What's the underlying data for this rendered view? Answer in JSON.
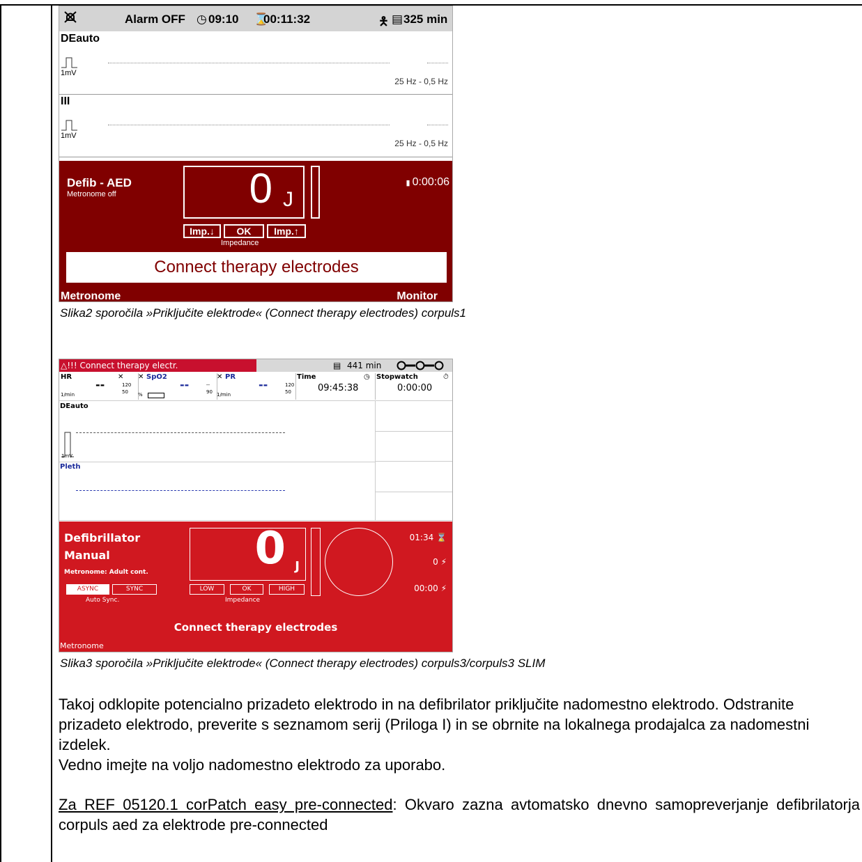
{
  "screen1": {
    "status_bar": {
      "alarm_icon": "alarm-off-icon",
      "alarm": "Alarm OFF",
      "clock_icon": "clock-icon",
      "clock": "09:10",
      "timer_icon": "hourglass-icon",
      "timer": "00:11:32",
      "patient_icon": "patient-adult-icon",
      "battery_icon": "battery-icon",
      "battery": "325 min"
    },
    "leads": [
      {
        "name": "DEauto",
        "scale": "1mV",
        "filter": "25 Hz - 0,5 Hz"
      },
      {
        "name": "III",
        "scale": "1mV",
        "filter": "25 Hz - 0,5 Hz"
      }
    ],
    "defib": {
      "mode": "Defib - AED",
      "metronome": "Metronome off",
      "energy_value": "0",
      "energy_unit": "J",
      "elapsed": "0:00:06",
      "btn_imp_down": "Imp.↓",
      "btn_ok": "OK",
      "btn_imp_up": "Imp.↑",
      "impedance_label": "Impedance",
      "message": "Connect therapy electrodes"
    },
    "softkeys": {
      "left": "Metronome",
      "right": "Monitor"
    }
  },
  "caption1": "Slika2 sporočila »Priključite elektrode« (Connect therapy electrodes) corpuls1",
  "screen2": {
    "alarm_text": "!!! Connect therapy electr.",
    "battery": "441 min",
    "params": [
      {
        "label": "HR",
        "value": "--",
        "high": "120",
        "low": "50",
        "unit": "1/min"
      },
      {
        "label": "SpO2",
        "value": "--",
        "high": "--",
        "low": "90",
        "unit": "%"
      },
      {
        "label": "PR",
        "value": "--",
        "high": "120",
        "low": "50",
        "unit": "1/min"
      }
    ],
    "time_label": "Time",
    "time_value": "09:45:38",
    "stopwatch_label": "Stopwatch",
    "stopwatch_value": "0:00:00",
    "wave1_label": "DEauto",
    "wave1_scale": "1mV",
    "wave2_label": "Pleth",
    "defib": {
      "title_line1": "Defibrillator",
      "title_line2": "Manual",
      "metronome": "Metronome: Adult cont.",
      "btn_async": "ASYNC",
      "btn_sync": "SYNC",
      "auto_sync": "Auto Sync.",
      "energy_value": "0",
      "energy_unit": "J",
      "btn_low": "LOW",
      "btn_ok": "OK",
      "btn_high": "HIGH",
      "impedance_label": "Impedance",
      "timer1": "01:34",
      "shocks": "0",
      "timer2": "00:00",
      "message": "Connect therapy electrodes",
      "softkey": "Metronome"
    }
  },
  "caption2": "Slika3 sporočila »Priključite elektrode« (Connect therapy electrodes) corpuls3/corpuls3 SLIM",
  "paragraph1": "Takoj odklopite potencialno prizadeto elektrodo in na defibrilator priključite nadomestno elektrodo. Odstranite prizadeto elektrodo, preverite s seznamom serij (Priloga I) in se obrnite na lokalnega prodajalca za nadomestni izdelek.",
  "paragraph2": "Vedno imejte na voljo nadomestno elektrodo za uporabo.",
  "paragraph3_link": "Za REF 05120.1 corPatch easy pre-connected",
  "paragraph3_rest": ": Okvaro zazna avtomatsko dnevno samopreverjanje defibrilatorja corpuls aed za elektrode pre-connected"
}
